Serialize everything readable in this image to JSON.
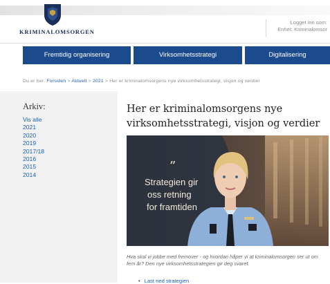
{
  "header": {
    "logo_text": "KRIMINALOMSORGEN",
    "login_line1": "Logget inn som:",
    "login_line2": "Enhet: Kriminalomsor"
  },
  "nav": {
    "items": [
      {
        "label": "Fremtidig organisering"
      },
      {
        "label": "Virksomhetsstrategi"
      },
      {
        "label": "Digitalisering"
      }
    ]
  },
  "breadcrumb": {
    "prefix": "Du er her:",
    "items": [
      "Forsiden",
      "Aktuelt",
      "2021"
    ],
    "separator": ">",
    "current": "Her er kriminalomsorgens nye virksomhetsstrategi, visjon og verdier"
  },
  "sidebar": {
    "title": "Arkiv:",
    "items": [
      "Vis alle",
      "2021",
      "2020",
      "2019",
      "2017/18",
      "2016",
      "2015",
      "2014"
    ]
  },
  "article": {
    "title": "Her er kriminalomsorgens nye virksomhetsstrategi, visjon og verdier",
    "hero_quote_mark": "”",
    "hero_quote": [
      "Strategien gir",
      "oss retning",
      "for framtiden"
    ],
    "lead": "Hva skal vi jobbe med fremover - og hvordan håper vi at kriminalomsorgen ser ut om fem år? Den nye virksomhetsstrategien gir deg svaret.",
    "link": "Last ned strategien"
  },
  "colors": {
    "nav_blue": "#1b4b8c",
    "link_blue": "#1b5fae",
    "sidebar_bg": "#f2f2f2"
  }
}
